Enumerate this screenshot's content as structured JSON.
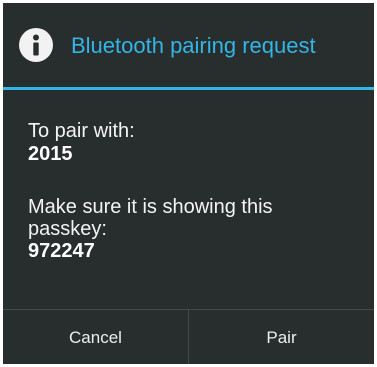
{
  "dialog": {
    "title": "Bluetooth pairing request",
    "icon": "info-icon",
    "accent_color": "#33b5e5",
    "background_color": "#282d2e",
    "pair_with_label": "To pair with:",
    "device_name": "2015",
    "passkey_prompt_line1": "Make sure it is showing this",
    "passkey_prompt_line2": "passkey:",
    "passkey": "972247"
  },
  "buttons": {
    "cancel_label": "Cancel",
    "pair_label": "Pair"
  }
}
